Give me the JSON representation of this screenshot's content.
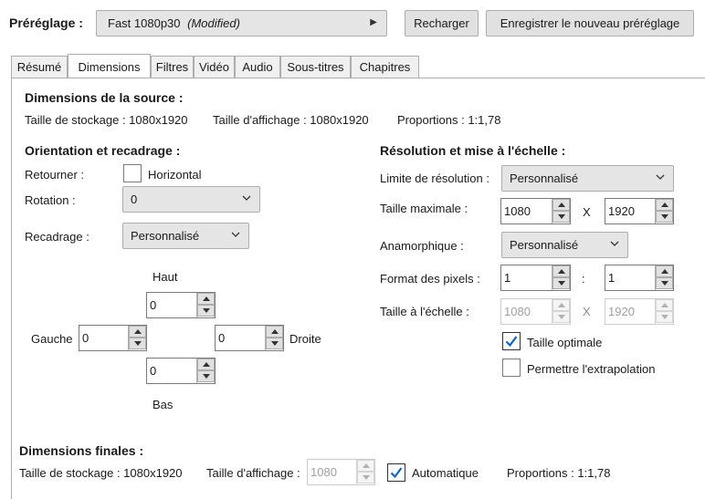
{
  "preset": {
    "label": "Préréglage :",
    "name": "Fast 1080p30",
    "modified": "(Modified)",
    "reload_button": "Recharger",
    "save_button": "Enregistrer le nouveau préréglage"
  },
  "tabs": [
    "Résumé",
    "Dimensions",
    "Filtres",
    "Vidéo",
    "Audio",
    "Sous-titres",
    "Chapitres"
  ],
  "active_tab": "Dimensions",
  "source": {
    "heading": "Dimensions de la source :",
    "storage": "Taille de stockage : 1080x1920",
    "display": "Taille d'affichage : 1080x1920",
    "aspect": "Proportions : 1:1,78"
  },
  "orientation": {
    "heading": "Orientation et recadrage :",
    "flip_label": "Retourner :",
    "flip_option": "Horizontal",
    "flip_checked": false,
    "rotation_label": "Rotation :",
    "rotation_value": "0",
    "crop_label": "Recadrage :",
    "crop_value": "Personnalisé",
    "top_label": "Haut",
    "bottom_label": "Bas",
    "left_label": "Gauche",
    "right_label": "Droite",
    "top_value": "0",
    "bottom_value": "0",
    "left_value": "0",
    "right_value": "0"
  },
  "resolution": {
    "heading": "Résolution et mise à l'échelle :",
    "limit_label": "Limite de résolution :",
    "limit_value": "Personnalisé",
    "max_label": "Taille maximale :",
    "max_width": "1080",
    "max_height": "1920",
    "x_sep": "X",
    "anamorphic_label": "Anamorphique :",
    "anamorphic_value": "Personnalisé",
    "pixel_format_label": "Format des pixels :",
    "par_width": "1",
    "par_height": "1",
    "colon_sep": ":",
    "scaled_label": "Taille à l'échelle :",
    "scaled_width": "1080",
    "scaled_height": "1920",
    "optimal_label": "Taille optimale",
    "optimal_checked": true,
    "upscale_label": "Permettre l'extrapolation",
    "upscale_checked": false
  },
  "final": {
    "heading": "Dimensions finales :",
    "storage": "Taille de stockage : 1080x1920",
    "display_label": "Taille d'affichage :",
    "display_value": "1080",
    "auto_label": "Automatique",
    "auto_checked": true,
    "aspect": "Proportions : 1:1,78"
  },
  "icons": {
    "combo_arrow": "chevron-down-icon",
    "preset_arrow": "triangle-right-icon",
    "check": "checkmark-icon"
  },
  "colors": {
    "check_blue": "#0a64c8",
    "border": "#adadad",
    "button_bg": "#e1e1e1"
  }
}
